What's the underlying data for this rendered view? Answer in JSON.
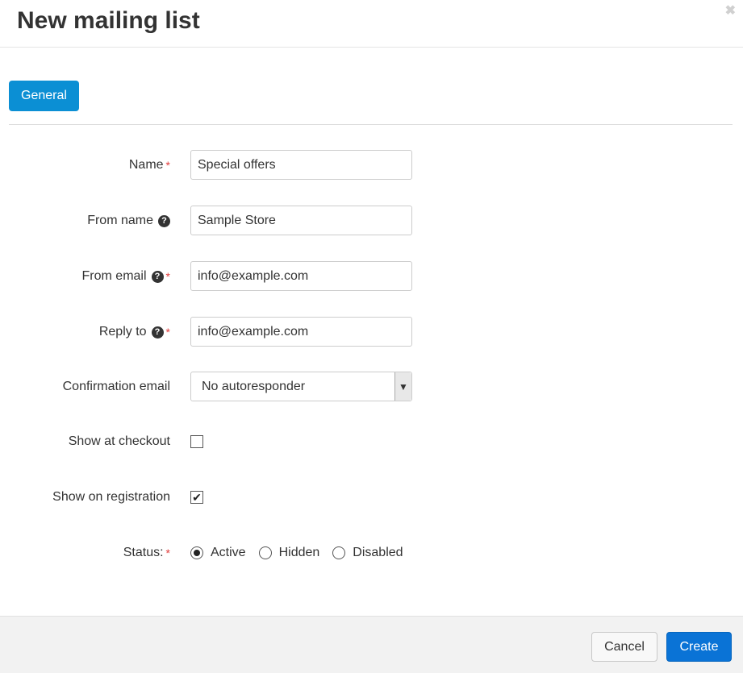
{
  "dialog": {
    "title": "New mailing list",
    "close_glyph": "✖"
  },
  "tabs": [
    {
      "label": "General",
      "active": true
    }
  ],
  "form": {
    "name": {
      "label": "Name",
      "required_mark": "*",
      "value": "Special offers"
    },
    "from_name": {
      "label": "From name",
      "help_icon": "question-circle-icon",
      "value": "Sample Store"
    },
    "from_email": {
      "label": "From email",
      "help_icon": "question-circle-icon",
      "required_mark": "*",
      "value": "info@example.com"
    },
    "reply_to": {
      "label": "Reply to",
      "help_icon": "question-circle-icon",
      "required_mark": "*",
      "value": "info@example.com"
    },
    "confirmation_email": {
      "label": "Confirmation email",
      "selected": "No autoresponder"
    },
    "show_at_checkout": {
      "label": "Show at checkout",
      "checked": false
    },
    "show_on_registration": {
      "label": "Show on registration",
      "checked": true,
      "check_glyph": "✔"
    },
    "status": {
      "label": "Status:",
      "required_mark": "*",
      "options": [
        "Active",
        "Hidden",
        "Disabled"
      ],
      "selected": "Active"
    }
  },
  "footer": {
    "cancel_label": "Cancel",
    "create_label": "Create"
  },
  "colors": {
    "primary": "#0a73d6",
    "tab_active": "#0b8fd4",
    "required": "#e03b3b"
  }
}
